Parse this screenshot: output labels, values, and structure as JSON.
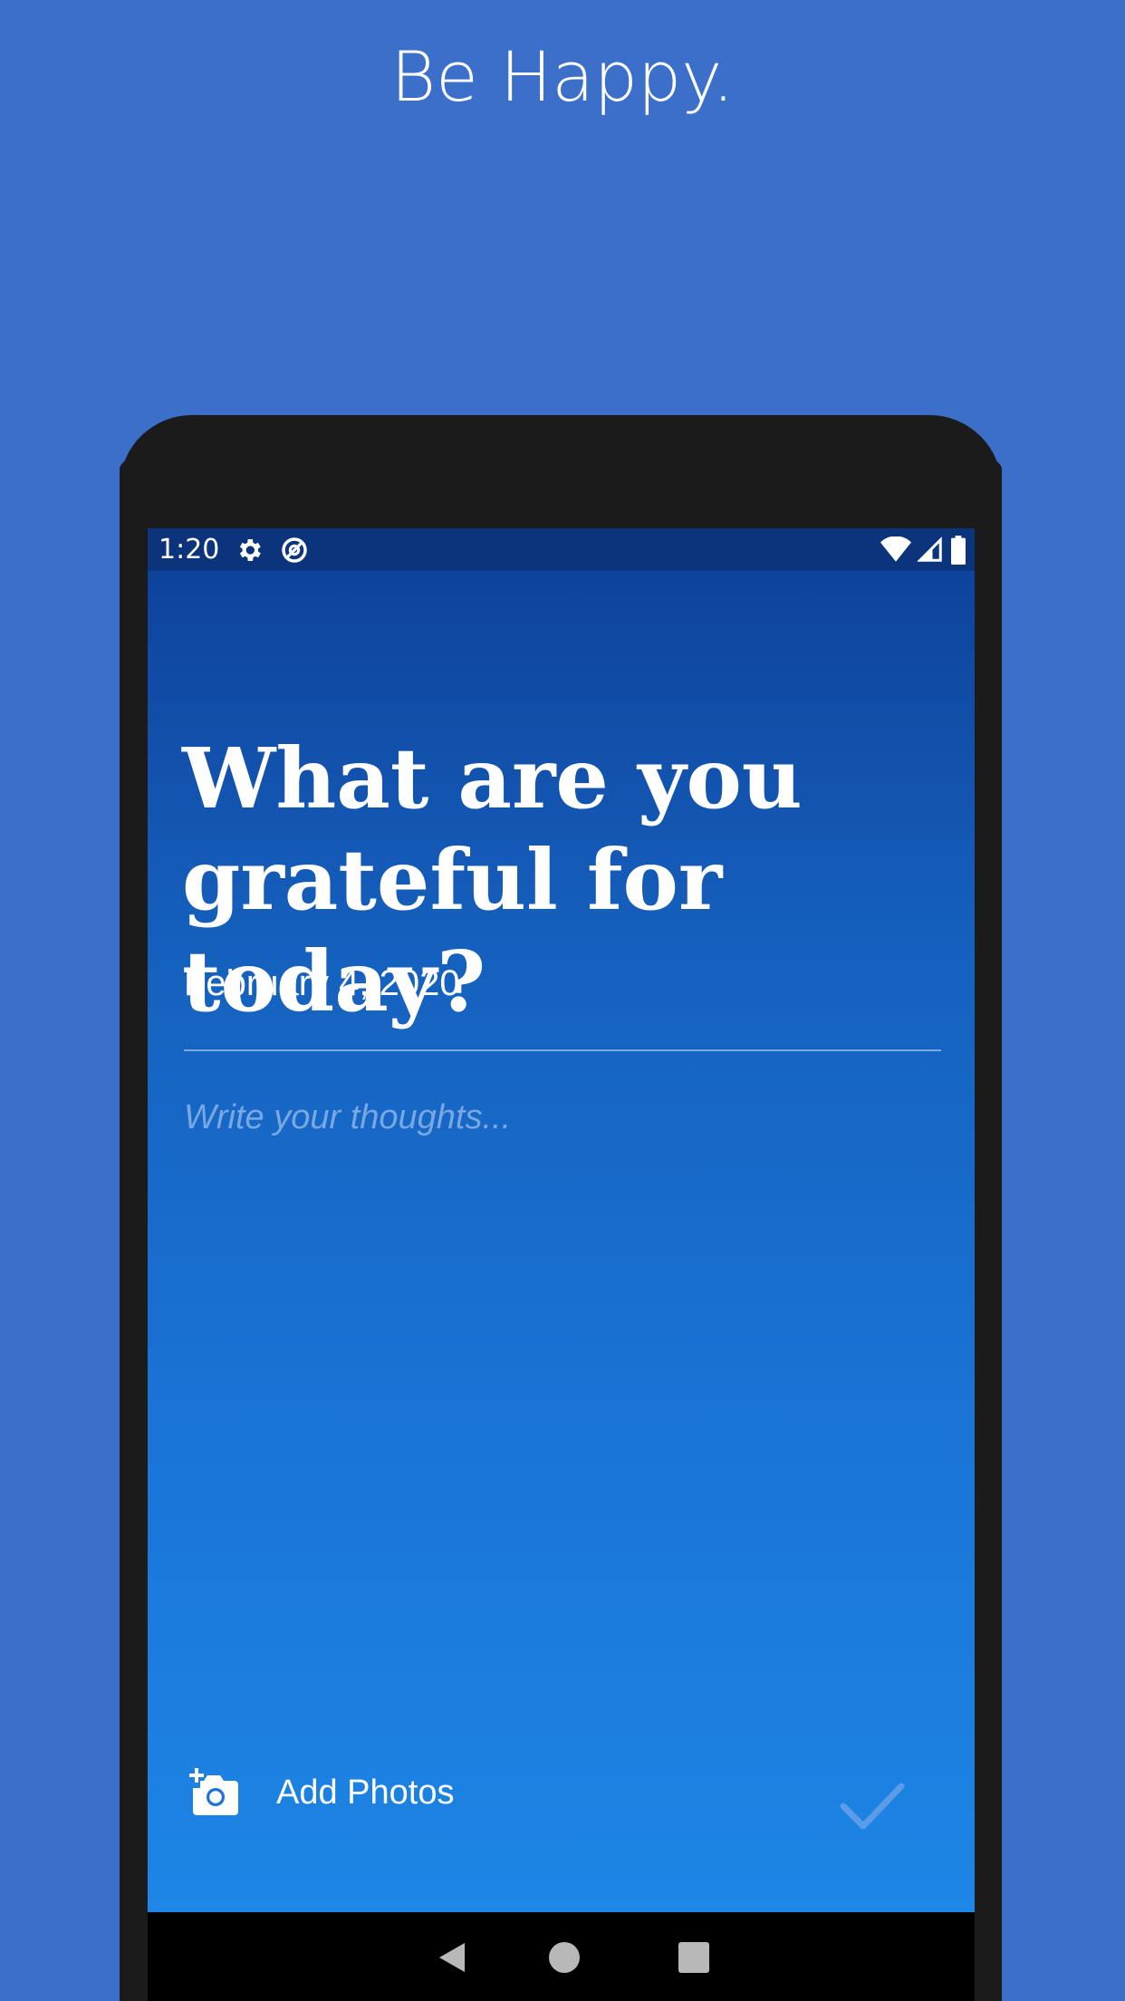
{
  "tagline": "Be Happy.",
  "status_bar": {
    "time": "1:20",
    "icons": [
      "gear-icon",
      "at-sign-icon",
      "wifi-icon",
      "signal-icon",
      "battery-icon"
    ]
  },
  "entry": {
    "heading_line1": "What are you",
    "heading_line2": "grateful for today?",
    "date": "February 4, 2020",
    "placeholder": "Write your thoughts..."
  },
  "actions": {
    "add_photos_label": "Add Photos",
    "add_photos_icon": "add-a-photo-icon",
    "confirm_icon": "check-icon"
  },
  "nav": {
    "icons": [
      "back-icon",
      "home-icon",
      "recents-icon"
    ]
  },
  "colors": {
    "background": "#3b6fca",
    "device": "#1b1b1b",
    "status_bar": "#0b347c",
    "gradient_top": "#0d3f98",
    "gradient_bottom": "#1d86e6",
    "text": "#ffffff",
    "check": "#5b9be8"
  }
}
